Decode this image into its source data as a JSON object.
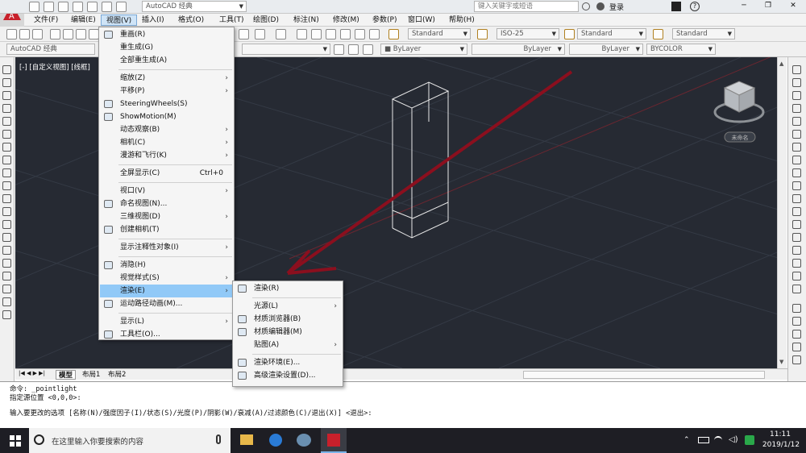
{
  "titlebar": {
    "workspace": "AutoCAD 经典",
    "search_placeholder": "键入关键字或短语",
    "login": "登录"
  },
  "menubar": [
    "文件(F)",
    "编辑(E)",
    "视图(V)",
    "插入(I)",
    "格式(O)",
    "工具(T)",
    "绘图(D)",
    "标注(N)",
    "修改(M)",
    "参数(P)",
    "窗口(W)",
    "帮助(H)"
  ],
  "toolbar1": {
    "text_style": "Standard",
    "dim_style": "ISO-25",
    "table_style": "Standard",
    "mleader_style": "Standard"
  },
  "toolbar2": {
    "workspace": "AutoCAD 经典",
    "color": "ByLayer",
    "linetype": "ByLayer",
    "lineweight": "ByLayer",
    "plotstyle": "BYCOLOR"
  },
  "viewport": {
    "label": "[-] [自定义视图] [线框]",
    "viewcube_label": "未命名"
  },
  "view_menu": [
    {
      "label": "重画(R)",
      "icon": "pencil-icon"
    },
    {
      "label": "重生成(G)"
    },
    {
      "label": "全部重生成(A)"
    },
    {
      "sep": true
    },
    {
      "label": "缩放(Z)",
      "sub": true
    },
    {
      "label": "平移(P)",
      "sub": true
    },
    {
      "label": "SteeringWheels(S)",
      "icon": "steering-wheel-icon"
    },
    {
      "label": "ShowMotion(M)",
      "icon": "showmotion-icon"
    },
    {
      "label": "动态观察(B)",
      "sub": true
    },
    {
      "label": "相机(C)",
      "sub": true
    },
    {
      "label": "漫游和飞行(K)",
      "sub": true
    },
    {
      "sep": true
    },
    {
      "label": "全屏显示(C)",
      "shortcut": "Ctrl+0"
    },
    {
      "sep": true
    },
    {
      "label": "视口(V)",
      "sub": true
    },
    {
      "label": "命名视图(N)...",
      "icon": "named-view-icon"
    },
    {
      "label": "三维视图(D)",
      "sub": true
    },
    {
      "label": "创建相机(T)",
      "icon": "camera-icon"
    },
    {
      "sep": true
    },
    {
      "label": "显示注释性对象(I)",
      "sub": true
    },
    {
      "sep": true
    },
    {
      "label": "消隐(H)",
      "icon": "hide-icon"
    },
    {
      "label": "视觉样式(S)",
      "sub": true
    },
    {
      "label": "渲染(E)",
      "sub": true,
      "highlighted": true
    },
    {
      "label": "运动路径动画(M)...",
      "icon": "motion-path-icon"
    },
    {
      "sep": true
    },
    {
      "label": "显示(L)",
      "sub": true
    },
    {
      "label": "工具栏(O)...",
      "icon": "toolbar-icon"
    }
  ],
  "render_submenu": [
    {
      "label": "渲染(R)",
      "icon": "teapot-icon"
    },
    {
      "sep": true
    },
    {
      "label": "光源(L)",
      "sub": true
    },
    {
      "label": "材质浏览器(B)",
      "icon": "materials-browser-icon"
    },
    {
      "label": "材质编辑器(M)",
      "icon": "materials-editor-icon"
    },
    {
      "label": "贴图(A)",
      "sub": true
    },
    {
      "sep": true
    },
    {
      "label": "渲染环境(E)...",
      "icon": "render-environment-icon"
    },
    {
      "label": "高级渲染设置(D)...",
      "icon": "advanced-render-icon"
    }
  ],
  "layout_tabs": [
    "模型",
    "布局1",
    "布局2"
  ],
  "command": {
    "line1": "命令: _pointlight",
    "line2": "指定源位置 <0,0,0>:",
    "prompt": "输入要更改的选项 [名称(N)/强度因子(I)/状态(S)/光度(P)/阴影(W)/衰减(A)/过滤颜色(C)/退出(X)] <退出>:"
  },
  "taskbar": {
    "search_text": "在这里输入你要搜索的内容",
    "time": "11:11",
    "date": "2019/1/12"
  },
  "colors": {
    "viewport_bg": "#262a33",
    "arrow": "#8b0f1e",
    "highlight": "#91c9f7"
  }
}
